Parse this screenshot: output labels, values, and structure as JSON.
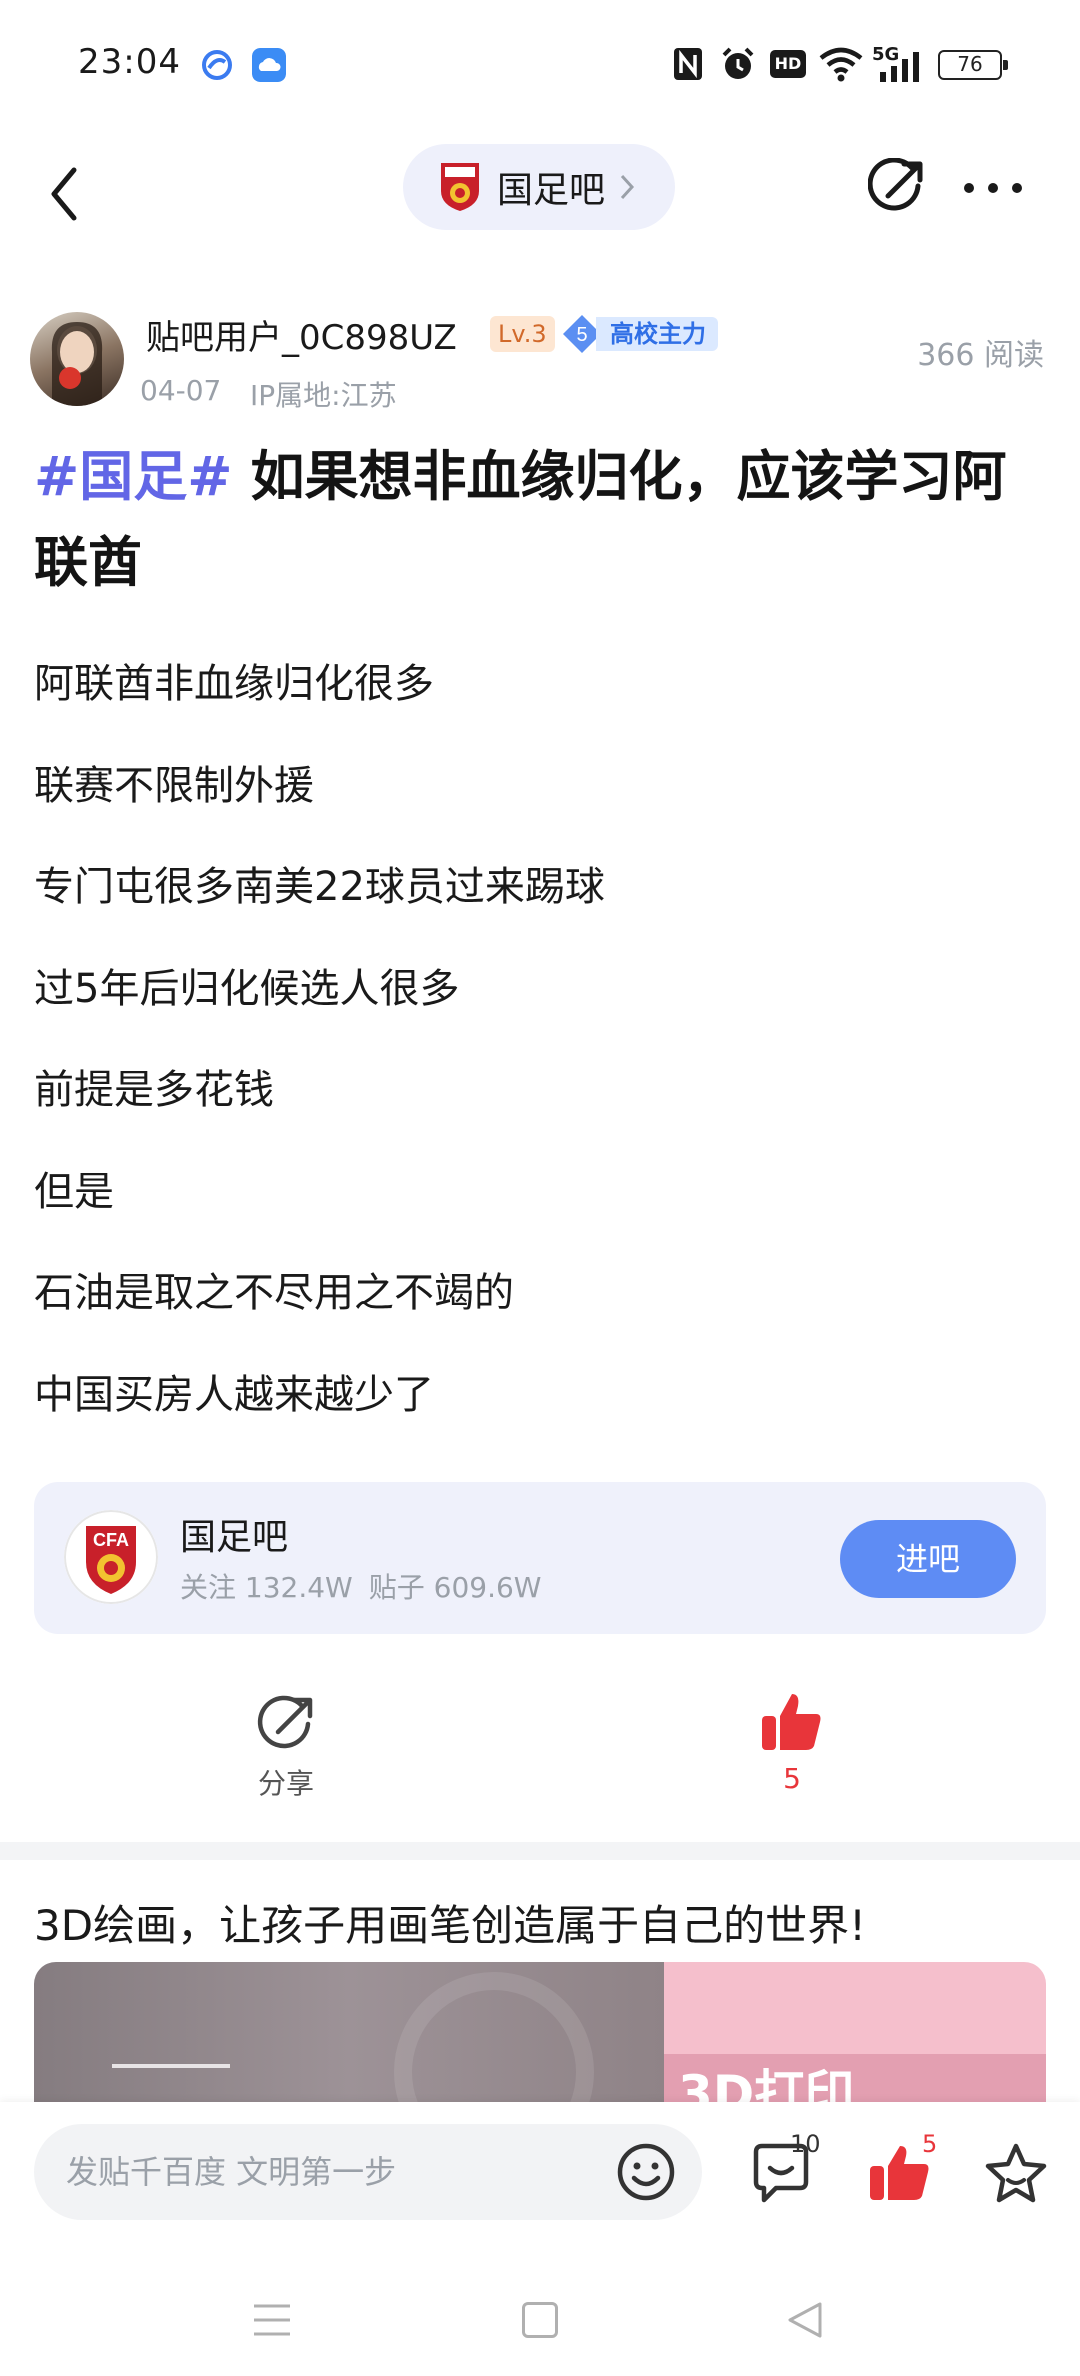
{
  "status_bar": {
    "time": "23:04",
    "icons": [
      "baidu-app-icon",
      "cloud-app-icon",
      "nfc-icon",
      "alarm-icon",
      "hd-icon",
      "wifi-icon",
      "signal-5g-icon"
    ],
    "network": "5G",
    "hd": "HD",
    "battery": "76"
  },
  "nav": {
    "forum_name": "国足吧",
    "icons": [
      "back-icon",
      "chevron-right-icon",
      "share-icon",
      "more-icon"
    ]
  },
  "post": {
    "author": {
      "username": "贴吧用户_0C898UZ",
      "level": "Lv.3",
      "school_level": "5",
      "school_badge": "高校主力",
      "date": "04-07",
      "ip": "IP属地:江苏"
    },
    "reads": "366 阅读",
    "topic_tag": "#国足#",
    "title": "如果想非血缘归化，应该学习阿联酋",
    "body": [
      "阿联酋非血缘归化很多",
      "联赛不限制外援",
      "专门屯很多南美22球员过来踢球",
      "过5年后归化候选人很多",
      "前提是多花钱",
      "但是",
      "石油是取之不尽用之不竭的",
      "中国买房人越来越少了"
    ]
  },
  "forum_card": {
    "name": "国足吧",
    "followers": "关注 132.4W",
    "posts": "贴子 609.6W",
    "enter_label": "进吧",
    "logo_text": "CFA"
  },
  "actions": {
    "share_label": "分享",
    "like_count": "5"
  },
  "ad": {
    "title": "3D绘画，让孩子用画笔创造属于自己的世界!",
    "image_text": "3D打印"
  },
  "bottom_bar": {
    "input_placeholder": "发贴千百度 文明第一步",
    "comment_count": "10",
    "like_count": "5"
  },
  "colors": {
    "accent": "#6266e6",
    "button_blue": "#5e8cf4",
    "like_red": "#e8353a",
    "card_bg": "#eff1fb",
    "muted_text": "#9aa0a8"
  }
}
